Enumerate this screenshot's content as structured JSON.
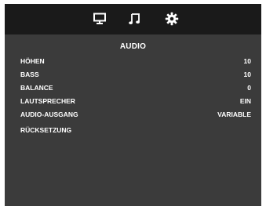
{
  "colors": {
    "panel_bg": "#3b3b3b",
    "topbar_bg": "#1a1a1a",
    "text": "#ffffff"
  },
  "tabs": [
    {
      "name": "monitor-icon"
    },
    {
      "name": "music-note-icon"
    },
    {
      "name": "gear-icon"
    }
  ],
  "menu": {
    "title": "AUDIO",
    "items": [
      {
        "label": "HÖHEN",
        "value": "10"
      },
      {
        "label": "BASS",
        "value": "10"
      },
      {
        "label": "BALANCE",
        "value": "0"
      },
      {
        "label": "LAUTSPRECHER",
        "value": "EIN"
      },
      {
        "label": "AUDIO-AUSGANG",
        "value": "VARIABLE"
      },
      {
        "label": "RÜCKSETZUNG",
        "value": ""
      }
    ]
  }
}
